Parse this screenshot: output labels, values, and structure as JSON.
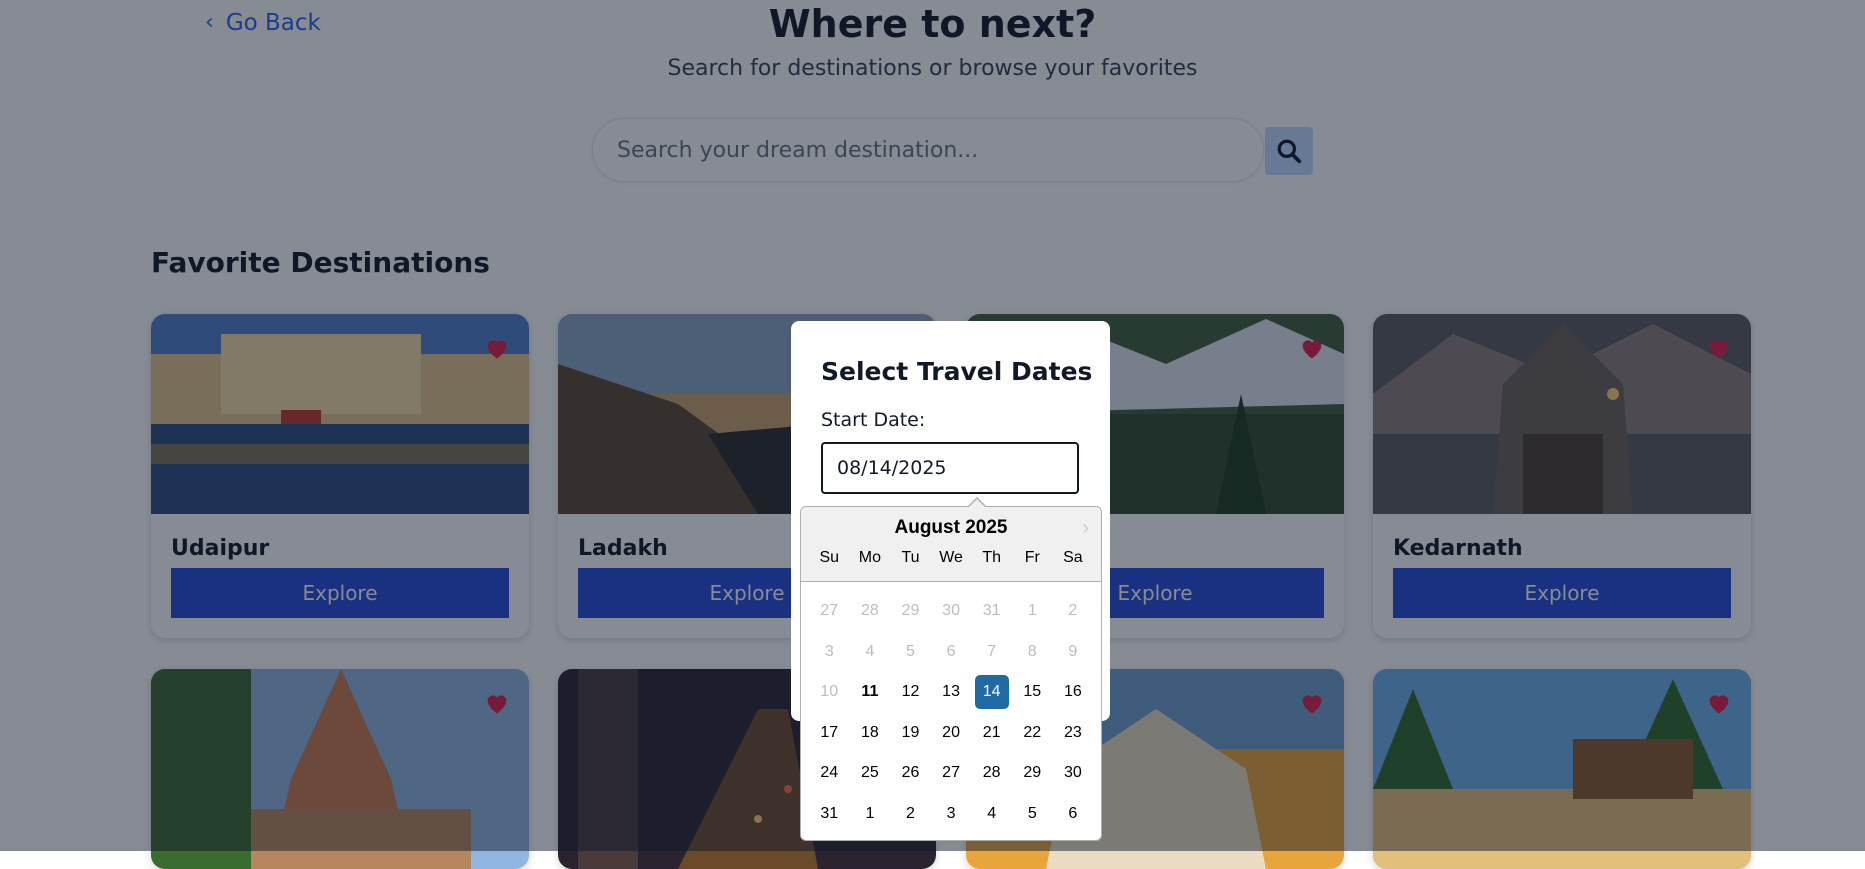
{
  "header": {
    "back_label": "Go Back",
    "title": "Where to next?",
    "subtitle": "Search for destinations or browse your favorites"
  },
  "search": {
    "placeholder": "Search your dream destination..."
  },
  "favorites": {
    "title": "Favorite Destinations",
    "explore_label": "Explore",
    "cards": [
      {
        "name": "Udaipur"
      },
      {
        "name": "Ladakh"
      },
      {
        "name": ""
      },
      {
        "name": "Kedarnath"
      },
      {
        "name": ""
      },
      {
        "name": ""
      },
      {
        "name": ""
      },
      {
        "name": ""
      }
    ]
  },
  "modal": {
    "title": "Select Travel Dates",
    "start_label": "Start Date:",
    "start_value": "08/14/2025"
  },
  "datepicker": {
    "month": "August 2025",
    "weekdays": [
      "Su",
      "Mo",
      "Tu",
      "We",
      "Th",
      "Fr",
      "Sa"
    ],
    "weeks": [
      [
        "27",
        "28",
        "29",
        "30",
        "31",
        "1",
        "2"
      ],
      [
        "3",
        "4",
        "5",
        "6",
        "7",
        "8",
        "9"
      ],
      [
        "10",
        "11",
        "12",
        "13",
        "14",
        "15",
        "16"
      ],
      [
        "17",
        "18",
        "19",
        "20",
        "21",
        "22",
        "23"
      ],
      [
        "24",
        "25",
        "26",
        "27",
        "28",
        "29",
        "30"
      ],
      [
        "31",
        "1",
        "2",
        "3",
        "4",
        "5",
        "6"
      ]
    ],
    "muted_days_first_weeks": 2,
    "muted_day": "10",
    "today": "11",
    "selected": "14"
  },
  "colors": {
    "accent": "#2449d8",
    "link": "#2563eb",
    "selected_day": "#216ba5",
    "heart": "#e11d48"
  }
}
